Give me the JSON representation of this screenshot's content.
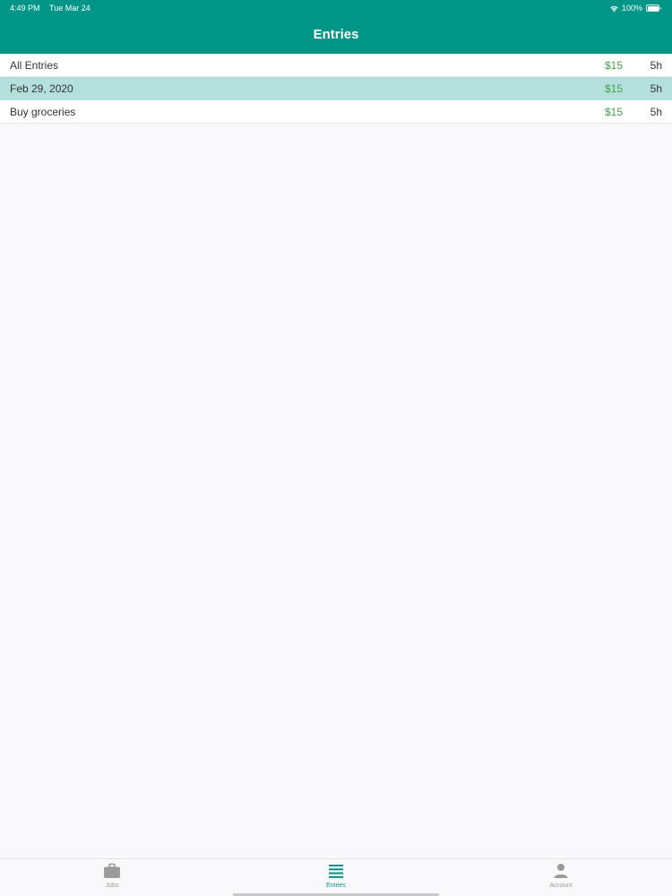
{
  "status_bar": {
    "time": "4:49 PM",
    "date": "Tue Mar 24",
    "battery": "100%"
  },
  "nav": {
    "title": "Entries"
  },
  "entries": [
    {
      "label": "All Entries",
      "pay": "$15",
      "hours": "5h",
      "selected": false
    },
    {
      "label": "Feb 29, 2020",
      "pay": "$15",
      "hours": "5h",
      "selected": true
    },
    {
      "label": "Buy groceries",
      "pay": "$15",
      "hours": "5h",
      "selected": false
    }
  ],
  "tabs": [
    {
      "label": "Jobs",
      "icon": "briefcase-icon",
      "active": false
    },
    {
      "label": "Entries",
      "icon": "list-icon",
      "active": true
    },
    {
      "label": "Account",
      "icon": "person-icon",
      "active": false
    }
  ],
  "colors": {
    "primary": "#009687",
    "selected_row": "#b3e0dc",
    "pay_text": "#43a047",
    "inactive_tab": "#9b9b9b"
  }
}
